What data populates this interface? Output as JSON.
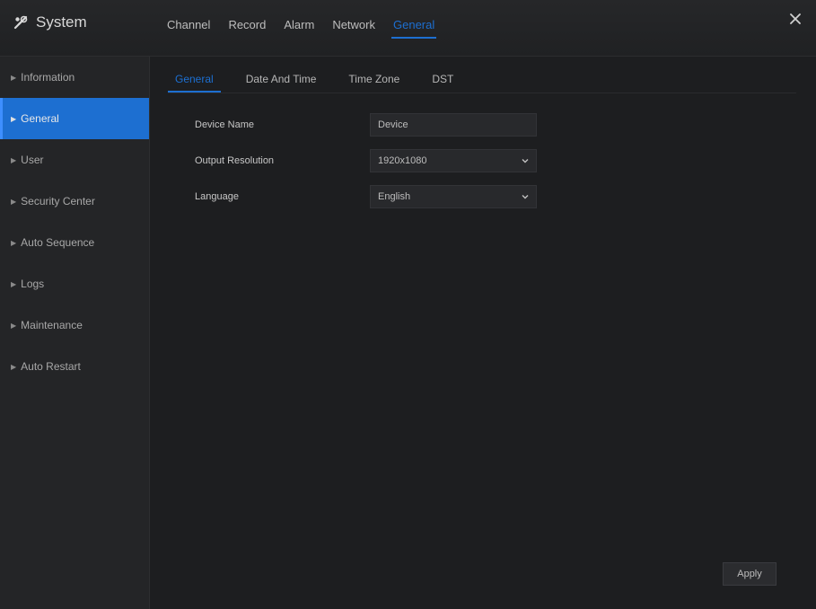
{
  "app": {
    "title": "System"
  },
  "main_tabs": [
    {
      "label": "Channel"
    },
    {
      "label": "Record"
    },
    {
      "label": "Alarm"
    },
    {
      "label": "Network"
    },
    {
      "label": "General",
      "active": true
    }
  ],
  "sidebar": {
    "items": [
      {
        "label": "Information"
      },
      {
        "label": "General",
        "active": true
      },
      {
        "label": "User"
      },
      {
        "label": "Security Center"
      },
      {
        "label": "Auto Sequence"
      },
      {
        "label": "Logs"
      },
      {
        "label": "Maintenance"
      },
      {
        "label": "Auto Restart"
      }
    ]
  },
  "sub_tabs": [
    {
      "label": "General",
      "active": true
    },
    {
      "label": "Date And Time"
    },
    {
      "label": "Time Zone"
    },
    {
      "label": "DST"
    }
  ],
  "form": {
    "device_name": {
      "label": "Device Name",
      "value": "Device"
    },
    "output_resolution": {
      "label": "Output Resolution",
      "value": "1920x1080"
    },
    "language": {
      "label": "Language",
      "value": "English"
    }
  },
  "actions": {
    "apply_label": "Apply"
  },
  "colors": {
    "accent": "#1d6fd1",
    "background": "#1b1c1e",
    "sidebar": "#242527"
  },
  "icons": {
    "app_icon": "tools-icon",
    "close": "close-icon",
    "dropdown": "chevron-down-icon",
    "bullet": "triangle-right-icon"
  }
}
